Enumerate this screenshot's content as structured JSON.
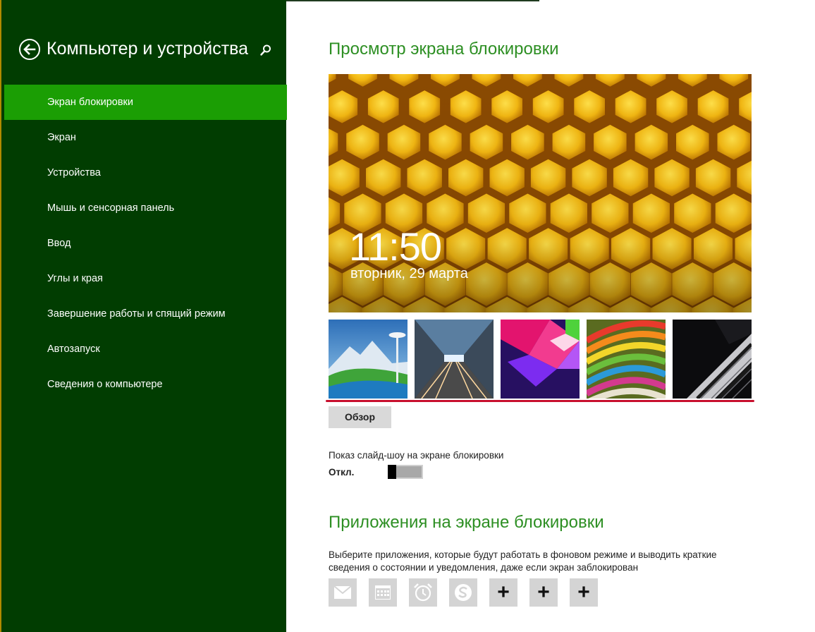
{
  "sidebar": {
    "title": "Компьютер и устройства",
    "items": [
      {
        "label": "Экран блокировки",
        "selected": true
      },
      {
        "label": "Экран"
      },
      {
        "label": "Устройства"
      },
      {
        "label": "Мышь и сенсорная панель"
      },
      {
        "label": "Ввод"
      },
      {
        "label": "Углы и края"
      },
      {
        "label": "Завершение работы и спящий режим"
      },
      {
        "label": "Автозапуск"
      },
      {
        "label": "Сведения о компьютере"
      }
    ]
  },
  "main": {
    "preview_heading": "Просмотр экрана блокировки",
    "preview": {
      "time": "11:50",
      "date": "вторник, 29 марта"
    },
    "thumbnails": [
      "mountain-space-needle",
      "tunnel-light-trails",
      "purple-geometric",
      "colorful-paper-curves",
      "piano-keys"
    ],
    "browse_button": "Обзор",
    "slideshow_label": "Показ слайд-шоу на экране блокировки",
    "slideshow_state": "Откл.",
    "slideshow_on": false,
    "apps_heading": "Приложения на экране блокировки",
    "apps_description": "Выберите приложения, которые будут работать в фоновом режиме и выводить краткие сведения о состоянии и уведомления, даже если экран заблокирован",
    "app_slots": [
      "mail-icon",
      "calendar-icon",
      "alarm-icon",
      "skype-icon",
      "+",
      "+",
      "+"
    ]
  },
  "colors": {
    "sidebar_bg": "#013d01",
    "selected_bg": "#1b9e04",
    "heading_green": "#2d8f23",
    "underline_red": "#c8102e"
  }
}
